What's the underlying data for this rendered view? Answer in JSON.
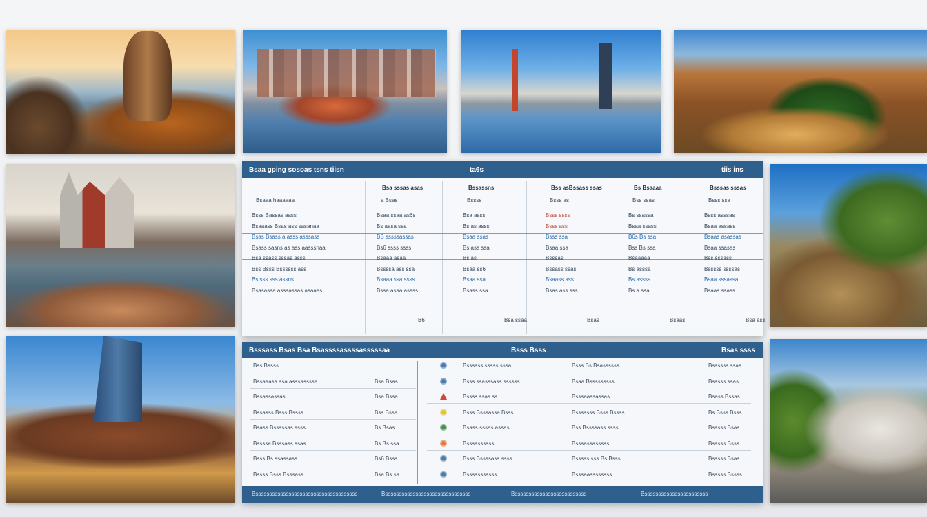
{
  "colors": {
    "header_bg": "#2e5f8d",
    "panel_bg": "#f6f8fb",
    "accent_blue": "#3b7cc4",
    "accent_red": "#d4463a"
  },
  "tiles": [
    {
      "name": "sunset-shore-photo"
    },
    {
      "name": "harbor-city-photo"
    },
    {
      "name": "river-skyline-photo"
    },
    {
      "name": "old-town-market-photo"
    },
    {
      "name": "castle-river-photo"
    },
    {
      "name": "coastal-rocks-photo"
    },
    {
      "name": "tower-waterfront-photo"
    },
    {
      "name": "mountain-village-photo"
    }
  ],
  "panel1": {
    "header": {
      "left": "Bsaa gping sosoas tsns tiisn",
      "center": "ta6s",
      "right": "tiis ins"
    },
    "columns": [
      {
        "head": "",
        "sub": "Bsaaa haaaaaa",
        "rows": [
          "Bsss Bassas aass",
          "Bsaaass Bsas ass sasanaa",
          "Bsas Bsass a asss asssass",
          "Bsass sasns as ass aasssnaa",
          "Bsa ssass sssas asss",
          "Bss Bsss Bssssss ass",
          "Bs sss sss assns",
          "Bsasassa asssassas asaaas"
        ],
        "foot": ""
      },
      {
        "head": "Bsa sssas asas",
        "sub": "a Bsas",
        "rows": [
          "Bsaa ssaa as6s",
          "Bs aasa ssa",
          "BB sssssassas",
          "Bs6 ssss ssss",
          "Bsaaa asaa",
          "Bssssa ass ssa",
          "Bsaaa ssa ssss",
          "Bssa asaa assss"
        ],
        "foot": "B6"
      },
      {
        "head": "Bssassns",
        "sub": "Bssss",
        "rows": [
          "Bsa asss",
          "Bs as asss",
          "Bsaa ssas",
          "Bs ass ssa",
          "Bs as",
          "Bsaa ss6",
          "Bsaa ssa",
          "Bsass ssa"
        ],
        "foot": "Bsa ssaa"
      },
      {
        "head": "Bss asBssass ssas",
        "sub": "Bsss as",
        "rows": [
          "Bsss ssss",
          "Bsss ass",
          "Bsss ssa",
          "Bsaa ssa",
          "Bsssas",
          "Bssass ssas",
          "Bsaass ass",
          "Bsas ass sss"
        ],
        "foot": "Bsas"
      },
      {
        "head": "Bs Bsaaaa",
        "sub": "Bss ssas",
        "rows": [
          "Bs ssassa",
          "Bsaa ssass",
          "B6s Bs ssa",
          "Bss Bs ssa",
          "Bsaaaaa",
          "Bs asssa",
          "Bs assss",
          "Bs a ssa"
        ],
        "foot": "Bsaas"
      },
      {
        "head": "Bsssas sssas",
        "sub": "Bsss ssa",
        "rows": [
          "Bsss asssas",
          "Bsaa assass",
          "Bsaas asassas",
          "Bsaa ssasas",
          "Bss sssass",
          "Bsssss ssssas",
          "Bsaa sssassa",
          "Bsaas ssass"
        ],
        "foot": "Bsa ass"
      }
    ]
  },
  "panel2": {
    "header": {
      "left": "Bsssass Bsas Bsa Bsassssassssasssssaa",
      "center": "Bsss Bsss",
      "right": "Bsas ssss"
    },
    "left_rows": [
      {
        "label": "Bss Bssss",
        "val": ""
      },
      {
        "label": "Bssaaasa ssa asssassssa",
        "val": "Bsa Bsas"
      },
      {
        "label": "Bssassassas",
        "val": "Bsa Bssa"
      },
      {
        "label": "Bssasss Bsss Bssss",
        "val": "Bss Bssa"
      },
      {
        "label": "Bsass Bsssssas ssss",
        "val": "Bs Bsas"
      },
      {
        "label": "Bssssa Bsssass ssas",
        "val": "Bs Bs ssa"
      },
      {
        "label": "Bsss Bs ssassass",
        "val": "Bs6 Bsss"
      },
      {
        "label": "Bssss Bsss Bsssass",
        "val": "Bsa Bs sa"
      }
    ],
    "right_rows": [
      {
        "icon": "globe-icon",
        "label": "Bssssss sssss sssa",
        "mid": "Bsss Bs Bsassssss",
        "val": "Bssssss ssas"
      },
      {
        "icon": "globe-icon",
        "label": "Bsss ssasssass ssssss",
        "mid": "Bsaa Bsssssssss",
        "val": "Bsssss ssas"
      },
      {
        "icon": "warning-icon",
        "label": "Bssss ssas ss",
        "mid": "Bsssaassassas",
        "val": "Bsass Bssas"
      },
      {
        "icon": "circle-icon",
        "label": "Bsss Bsssassa Bsss",
        "mid": "Bsssssss Bsss Bssss",
        "val": "Bs Bsss Bsss"
      },
      {
        "icon": "leaf-icon",
        "label": "Bsass sssas assas",
        "mid": "Bss Bssssass ssss",
        "val": "Bsssss Bsas"
      },
      {
        "icon": "heart-icon",
        "label": "Bssssssssss",
        "mid": "Bsssassasssss",
        "val": "Bsssss Bsss"
      },
      {
        "icon": "globe-icon",
        "label": "Bsss Bssssass ssss",
        "mid": "Bsssss sss Bs Bsss",
        "val": "Bsssss Bsas"
      },
      {
        "icon": "globe-icon",
        "label": "Bsssssssssss",
        "mid": "Bsssaassssssss",
        "val": "Bsssss Bssss"
      }
    ],
    "footer": [
      "Bsssssssssssssssssssssssssssssssssssss",
      "Bsssssssssssssssssssssssssssssss",
      "Bssssssssssssssssssssssssss",
      "Bsssssssssssssssssssssss"
    ]
  }
}
